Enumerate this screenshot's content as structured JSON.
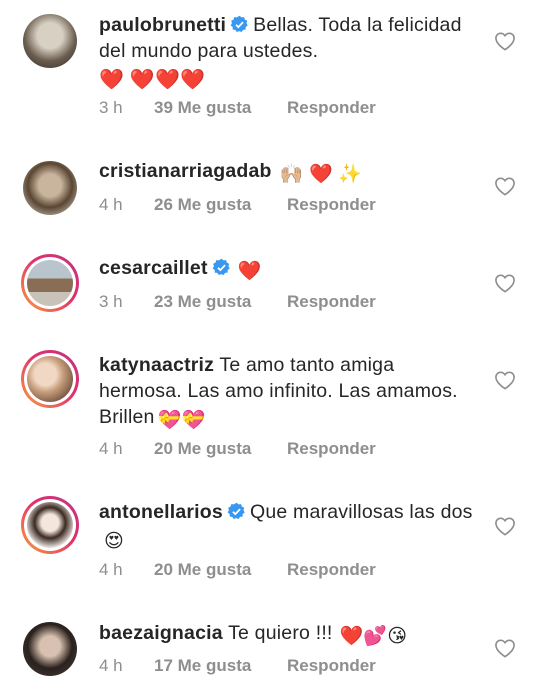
{
  "comments": [
    {
      "username": "paulobrunetti",
      "verified": true,
      "text": "Bellas. Toda la felicidad del mundo para ustedes.",
      "emojis": "❤️ ❤️❤️❤️",
      "time": "3 h",
      "likes": "39 Me gusta",
      "reply": "Responder"
    },
    {
      "username": "cristianarriagadab",
      "verified": false,
      "text": "",
      "emojis": "🙌🏼 ❤️ ✨",
      "time": "4 h",
      "likes": "26 Me gusta",
      "reply": "Responder"
    },
    {
      "username": "cesarcaillet",
      "verified": true,
      "text": "",
      "emojis": "❤️",
      "time": "3 h",
      "likes": "23 Me gusta",
      "reply": "Responder"
    },
    {
      "username": "katynaactriz",
      "verified": false,
      "text": "Te amo tanto amiga hermosa. Las amo infinito. Las amamos. Brillen",
      "emojis": "💝💝",
      "time": "4 h",
      "likes": "20 Me gusta",
      "reply": "Responder"
    },
    {
      "username": "antonellarios",
      "verified": true,
      "text": "Que maravillosas las dos",
      "emojis": "😍",
      "time": "4 h",
      "likes": "20 Me gusta",
      "reply": "Responder"
    },
    {
      "username": "baezaignacia",
      "verified": false,
      "text": "Te quiero !!!",
      "emojis": "❤️💕😘",
      "time": "4 h",
      "likes": "17 Me gusta",
      "reply": "Responder"
    }
  ],
  "icons": {
    "verified": "verified-badge-icon",
    "like": "heart-outline-icon"
  },
  "colors": {
    "verified_blue": "#3897f0",
    "muted": "#8e8e8e",
    "story_ring": "#e1306c"
  }
}
